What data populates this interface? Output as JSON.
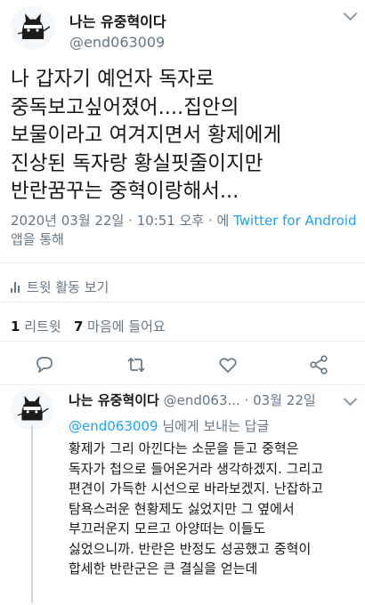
{
  "tweet": {
    "author_name": "나는 유중혁이다",
    "author_handle": "@end063009",
    "body": "나 갑자기 예언자 독자로\n중독보고싶어졌어....집안의\n보물이라고 여겨지면서 황제에게\n진상된 독자랑 황실핏줄이지만\n반란꿈꾸는 중혁이랑해서...",
    "timestamp": "2020년 03월 22일 · 10:51 오후",
    "via_prefix": "· 에",
    "via_link": "Twitter for Android",
    "via_suffix": "앱을 통해",
    "activity_label": "트윗 활동 보기",
    "retweet_count": "1",
    "retweet_label": "리트윗",
    "like_count": "7",
    "like_label": "마음에 들어요"
  },
  "reply": {
    "author_name": "나는 유중혁이다",
    "author_handle": "@end063...",
    "date": "· 03월 22일",
    "reply_to_handle": "@end063009",
    "reply_to_suffix": "님에게 보내는 답글",
    "body": "황제가 그리 아낀다는 소문을 듣고 중혁은\n독자가 첩으로 들어온거라 생각하겠지. 그리고\n편견이 가득한 시선으로 바라보겠지. 난잡하고\n탐욕스러운 현황제도 싫었지만 그 옆에서\n부끄러운지 모르고 아양떠는 이들도\n싫었으니까. 반란은 반정도 성공했고 중혁이\n합세한 반란군은 큰 결실을 얻는데"
  },
  "icons": {
    "avatar": "cat-avatar",
    "more": "chevron-down-icon",
    "activity": "bar-chart-icon",
    "reply": "comment-icon",
    "retweet": "retweet-icon",
    "like": "heart-icon",
    "share": "share-icon"
  },
  "colors": {
    "accent": "#1da1f2",
    "secondary_text": "#657786",
    "divider": "#e6ecf0"
  }
}
